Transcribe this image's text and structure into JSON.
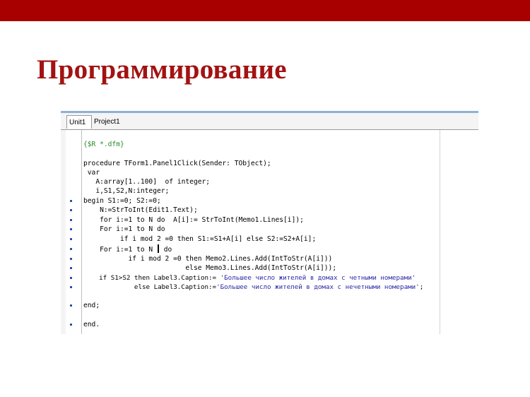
{
  "slide": {
    "title": "Программирование",
    "accent_color": "#a80000",
    "title_color": "#a31212"
  },
  "editor": {
    "tabs": [
      {
        "label": "Unit1",
        "active": true
      },
      {
        "label": "Project1",
        "active": false
      }
    ],
    "code_lines": [
      {
        "text": "{$R *.dfm}",
        "marker": false,
        "type": "comment"
      },
      {
        "text": "procedure TForm1.Panel1Click(Sender: TObject);",
        "marker": false
      },
      {
        "text": " var",
        "marker": false
      },
      {
        "text": "   A:array[1..100]  of integer;",
        "marker": false
      },
      {
        "text": "   i,S1,S2,N:integer;",
        "marker": false
      },
      {
        "text": "begin S1:=0; S2:=0;",
        "marker": true
      },
      {
        "text": "    N:=StrToInt(Edit1.Text);",
        "marker": true
      },
      {
        "text": "    for i:=1 to N do  A[i]:= StrToInt(Memo1.Lines[i]);",
        "marker": true
      },
      {
        "text": "    For i:=1 to N do",
        "marker": true
      },
      {
        "text": "         if i mod 2 =0 then S1:=S1+A[i] else S2:=S2+A[i];",
        "marker": true
      },
      {
        "text_before_cursor": "    For i:=1 to N ",
        "text_after_cursor": " do",
        "marker": true,
        "type": "cursor"
      },
      {
        "text": "           if i mod 2 =0 then Memo2.Lines.Add(IntToStr(A[i]))",
        "marker": true
      },
      {
        "text": "                         else Memo3.Lines.Add(IntToStr(A[i]));",
        "marker": true
      },
      {
        "code": "    if S1>S2 then Label3.Caption:= ",
        "string": "'Большее число жителей в домах с четными номерами'",
        "marker": true,
        "type": "mixed"
      },
      {
        "code": "             else Label3.Caption:=",
        "string": "'Большее число жителей в домах с нечетными номерами'",
        "code_after": ";",
        "marker": true,
        "type": "mixed"
      },
      {
        "text": "end;",
        "marker": true
      },
      {
        "text": "end.",
        "marker": true
      }
    ],
    "colors": {
      "comment": "#2a8a2a",
      "string": "#2a2aa6",
      "marker": "#1a3fa8"
    }
  }
}
